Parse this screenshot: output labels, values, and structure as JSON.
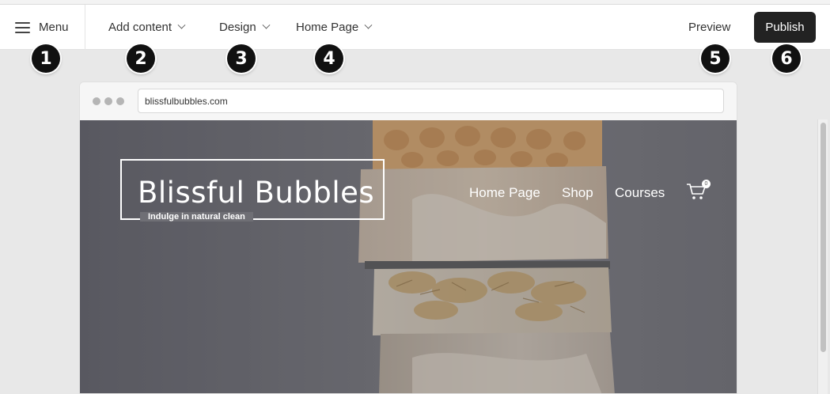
{
  "toolbar": {
    "menu_label": "Menu",
    "add_content_label": "Add content",
    "design_label": "Design",
    "page_label": "Home Page",
    "preview_label": "Preview",
    "publish_label": "Publish"
  },
  "badges": [
    "1",
    "2",
    "3",
    "4",
    "5",
    "6"
  ],
  "browser": {
    "url": "blissfulbubbles.com"
  },
  "site": {
    "title": "Blissful Bubbles",
    "tagline": "Indulge in natural clean",
    "nav": [
      "Home Page",
      "Shop",
      "Courses"
    ],
    "cart_count": "0"
  },
  "colors": {
    "publish_bg": "#222222",
    "badge_bg": "#111111",
    "hero_overlay": "#6a6a70"
  }
}
